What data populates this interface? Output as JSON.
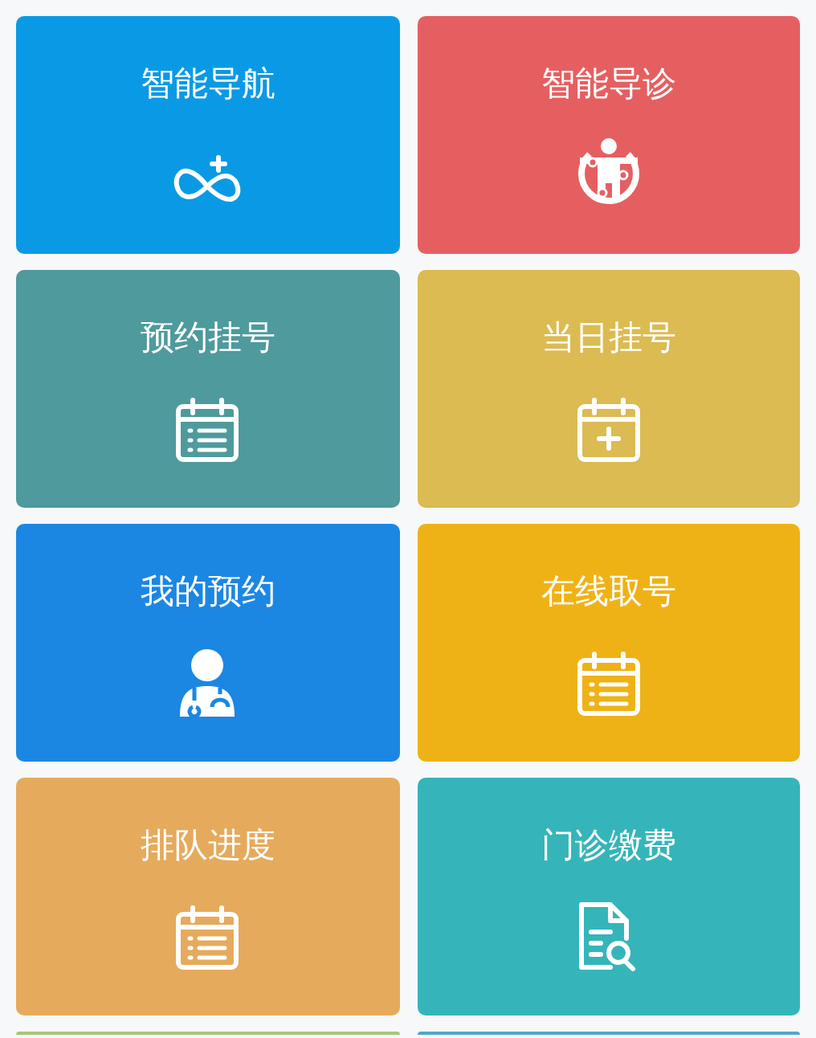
{
  "cards": [
    {
      "label": "智能导航",
      "color": "#0a9ae5"
    },
    {
      "label": "智能导诊",
      "color": "#e55f61"
    },
    {
      "label": "预约挂号",
      "color": "#4e9a9d"
    },
    {
      "label": "当日挂号",
      "color": "#dbbb52"
    },
    {
      "label": "我的预约",
      "color": "#1b87e3"
    },
    {
      "label": "在线取号",
      "color": "#efb216"
    },
    {
      "label": "排队进度",
      "color": "#e6aa5c"
    },
    {
      "label": "门诊缴费",
      "color": "#35b5ba"
    },
    {
      "color": "#a9c67c"
    },
    {
      "color": "#4fa7c9"
    }
  ]
}
